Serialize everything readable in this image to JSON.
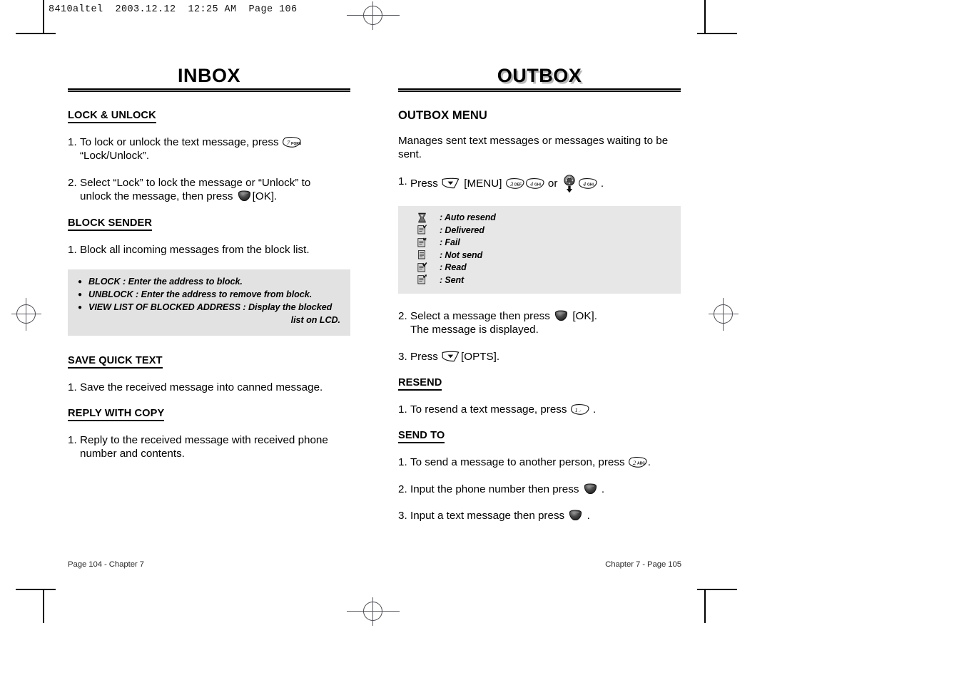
{
  "slug": "8410altel  2003.12.12  12:25 AM  Page 106",
  "left_page": {
    "chapter_title": "INBOX",
    "sections": [
      {
        "heading": "LOCK & UNLOCK",
        "underline": true,
        "steps": [
          {
            "num": "1.",
            "text": "To lock or unlock the text message, press ",
            "icons": [
              "key7"
            ],
            "after": "",
            "cont": "“Lock/Unlock”."
          },
          {
            "num": "2.",
            "text": "Select “Lock” to lock the message or “Unlock” to",
            "icons": [],
            "after": "",
            "cont": "unlock the message, then press ",
            "cont_icons": [
              "ok"
            ],
            "cont_after": "[OK]."
          }
        ]
      },
      {
        "heading": "BLOCK SENDER",
        "underline": true,
        "steps": [
          {
            "num": "1.",
            "text": "Block all incoming messages from the block list.",
            "icons": [],
            "after": ""
          }
        ]
      },
      {
        "heading": "SAVE QUICK TEXT",
        "underline": true,
        "steps": [
          {
            "num": "1.",
            "text": "Save the received message into canned message.",
            "icons": [],
            "after": ""
          }
        ]
      },
      {
        "heading": "REPLY WITH COPY",
        "underline": true,
        "steps": [
          {
            "num": "1.",
            "text": "Reply to the received message with received phone",
            "icons": [],
            "after": "",
            "cont": "number and contents."
          }
        ]
      }
    ],
    "callout": {
      "bullet_glyph": "●",
      "lines": [
        {
          "text": "BLOCK : Enter the address to block.",
          "hang": ""
        },
        {
          "text": "UNBLOCK : Enter the address to remove from block.",
          "hang": ""
        },
        {
          "text": "VIEW LIST OF BLOCKED ADDRESS : Display the blocked",
          "hang": "list on LCD."
        }
      ]
    },
    "footer": "Page 104 - Chapter 7"
  },
  "right_page": {
    "chapter_title": "OUTBOX",
    "menu_heading": "OUTBOX MENU",
    "intro": "Manages sent text messages or messages waiting to be sent.",
    "step1": {
      "num": "1.",
      "pre": "Press ",
      "label_menu": "[MENU]",
      "mid": " or ",
      "end": "."
    },
    "legend": {
      "items": [
        {
          "icon": "hourglass-icon",
          "label": ": Auto resend"
        },
        {
          "icon": "doc-check-icon",
          "label": ": Delivered"
        },
        {
          "icon": "doc-x-icon",
          "label": ": Fail"
        },
        {
          "icon": "doc-plain-icon",
          "label": ": Not send"
        },
        {
          "icon": "doc-read-icon",
          "label": ": Read"
        },
        {
          "icon": "doc-arrow-icon",
          "label": ": Sent"
        }
      ]
    },
    "steps": [
      {
        "num": "2.",
        "pre": "Select a message then press ",
        "post": "[OK].",
        "cont": "The message is displayed."
      },
      {
        "num": "3.",
        "pre": "Press ",
        "post": "[OPTS]."
      }
    ],
    "sections": [
      {
        "heading": "RESEND",
        "steps": [
          {
            "num": "1.",
            "pre": "To resend a text message, press ",
            "post": "."
          }
        ]
      },
      {
        "heading": "SEND TO",
        "steps": [
          {
            "num": "1.",
            "pre": "To send a message to another person, press ",
            "post": "."
          },
          {
            "num": "2.",
            "pre": "Input the phone number then press ",
            "post": "."
          },
          {
            "num": "3.",
            "pre": "Input a text message then press ",
            "post": "."
          }
        ]
      }
    ],
    "footer": "Chapter 7 - Page 105"
  },
  "keys": {
    "k1": "1",
    "k1sub": "·−",
    "k2": "2",
    "k2sub": "ABC",
    "k3": "3",
    "k3sub": "DEF",
    "k4": "4",
    "k4sub": "GHI",
    "k7": "7",
    "k7sub": "PQRS"
  },
  "colors": {
    "callout_bg": "#e2e2e2",
    "legend_bg": "#e7e7e7",
    "rule": "#000000",
    "title_shadow": "#b9b9b9"
  }
}
